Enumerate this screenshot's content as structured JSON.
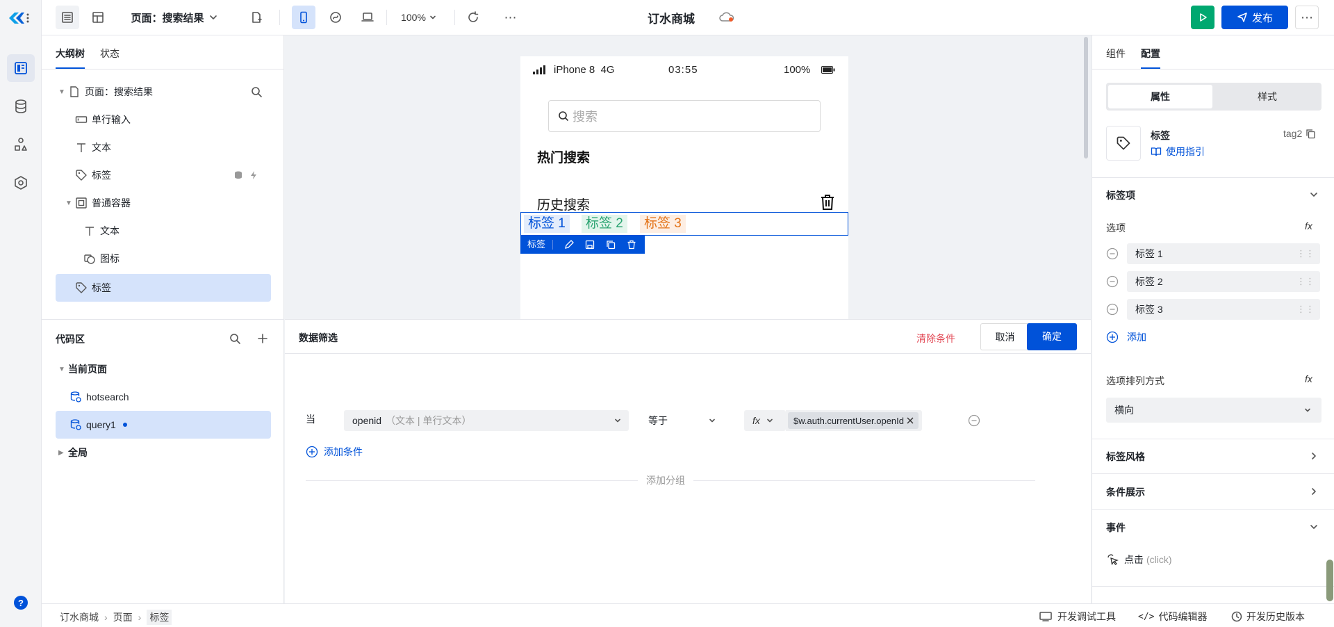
{
  "topbar": {
    "page_label": "页面：搜索结果",
    "zoom": "100%",
    "app_title": "订水商城",
    "publish_label": "发布"
  },
  "left_panel": {
    "tabs": [
      "大纲树",
      "状态"
    ],
    "tree": [
      {
        "label": "页面：搜索结果",
        "icon": "page-icon"
      },
      {
        "label": "单行输入",
        "icon": "input-icon"
      },
      {
        "label": "文本",
        "icon": "text-icon"
      },
      {
        "label": "标签",
        "icon": "tag-icon"
      },
      {
        "label": "普通容器",
        "icon": "container-icon"
      },
      {
        "label": "文本",
        "icon": "text-icon"
      },
      {
        "label": "图标",
        "icon": "image-icon"
      },
      {
        "label": "标签",
        "icon": "tag-icon"
      }
    ]
  },
  "code_panel": {
    "title": "代码区",
    "current_page": "当前页面",
    "items": [
      "hotsearch",
      "query1"
    ],
    "global": "全局"
  },
  "phone": {
    "carrier": "iPhone 8",
    "network": "4G",
    "time": "03:55",
    "battery": "100%",
    "search_placeholder": "搜索",
    "hot_search": "热门搜索",
    "history": "历史搜索",
    "tags": [
      "标签 1",
      "标签 2",
      "标签 3"
    ],
    "toolbar_label": "标签"
  },
  "filter": {
    "title": "数据筛选",
    "clear": "清除条件",
    "cancel": "取消",
    "confirm": "确定",
    "when": "当",
    "field": "openid",
    "field_type": "（文本 | 单行文本）",
    "operator": "等于",
    "fx": "fx",
    "value": "$w.auth.currentUser.openId",
    "add_condition": "添加条件",
    "add_group": "添加分组"
  },
  "right_panel": {
    "tabs": [
      "组件",
      "配置"
    ],
    "seg": [
      "属性",
      "样式"
    ],
    "comp_name": "标签",
    "comp_id": "tag2",
    "guide": "使用指引",
    "section_tags": "标签项",
    "options_label": "选项",
    "options": [
      "标签 1",
      "标签 2",
      "标签 3"
    ],
    "add": "添加",
    "arrange_label": "选项排列方式",
    "arrange_value": "横向",
    "style_section": "标签风格",
    "cond_section": "条件展示",
    "event_section": "事件",
    "event_click": "点击",
    "event_click_en": "(click)"
  },
  "statusbar": {
    "breadcrumb": [
      "订水商城",
      "页面",
      "标签"
    ],
    "devtools": "开发调试工具",
    "code_editor": "代码编辑器",
    "history": "开发历史版本"
  },
  "colors": {
    "primary": "#0052d9",
    "green": "#00a870",
    "danger": "#e34d59"
  }
}
